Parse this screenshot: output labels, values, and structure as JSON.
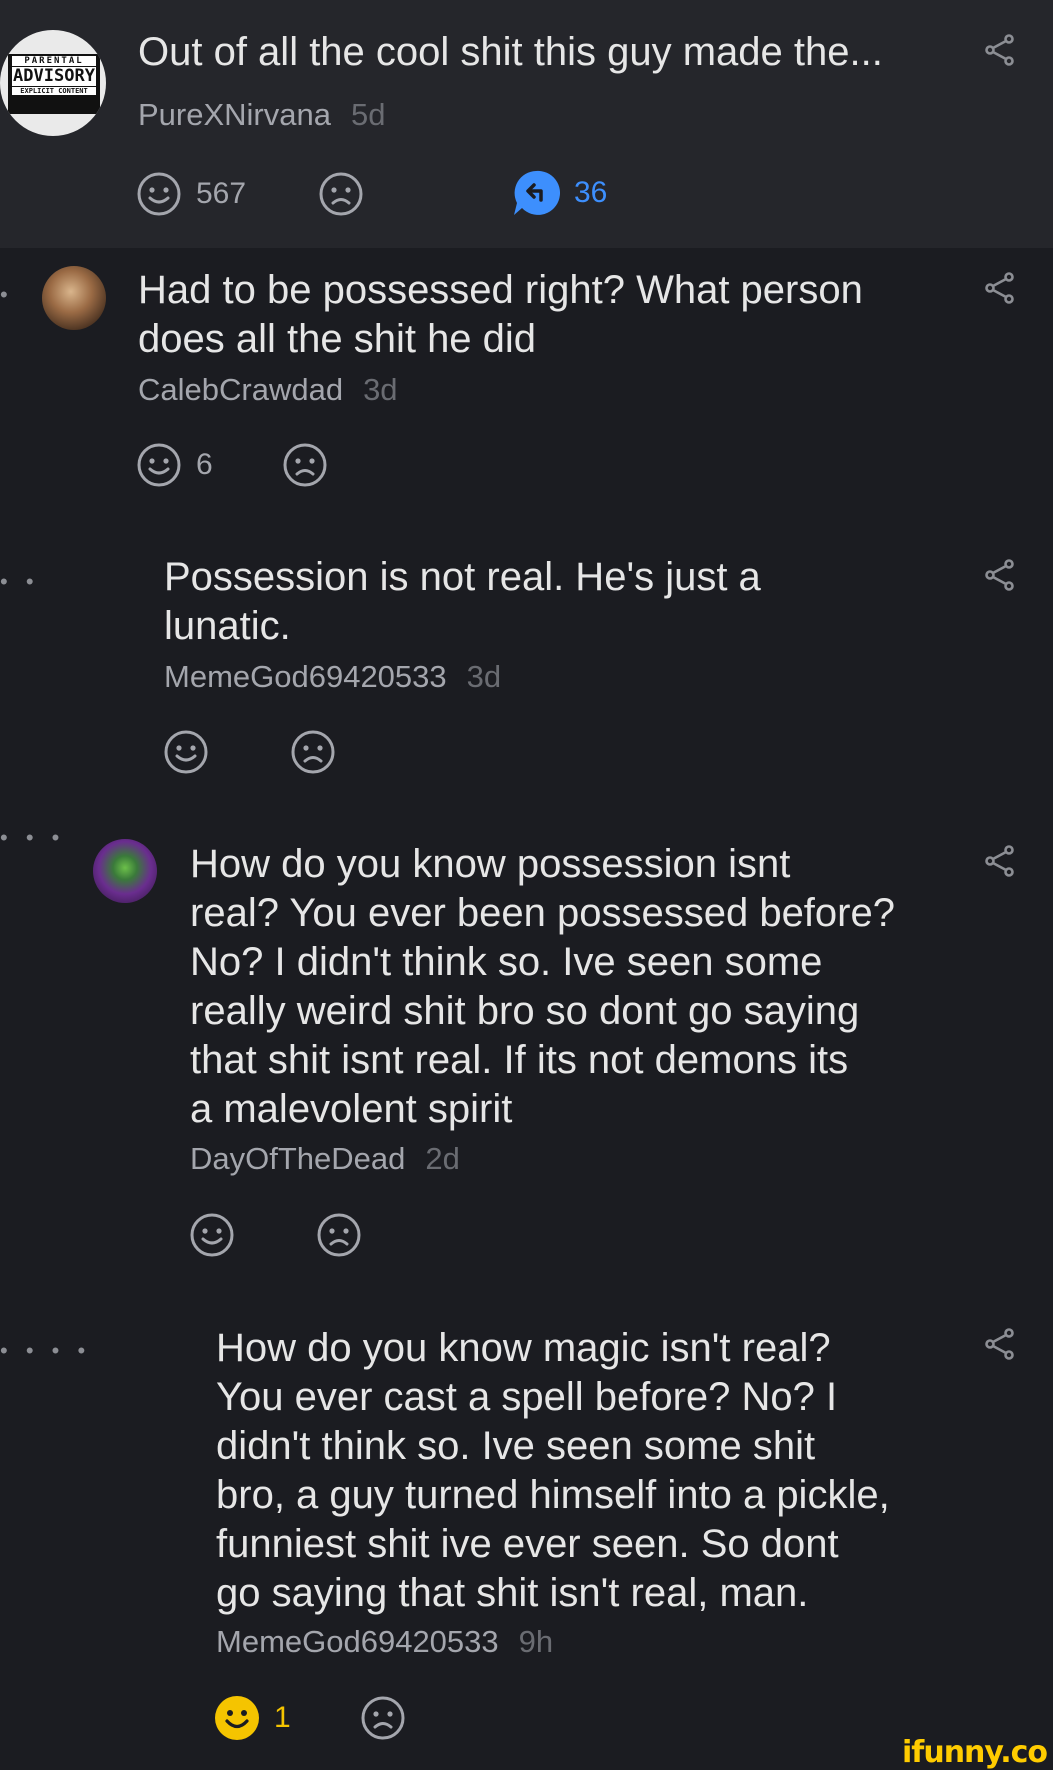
{
  "op": {
    "text": "Out of all the cool shit this guy made the...",
    "author": "PureXNirvana",
    "age": "5d",
    "likes": "567",
    "replies": "36",
    "avatar": {
      "line1": "PARENTAL",
      "line2": "ADVISORY",
      "line3": "EXPLICIT CONTENT"
    }
  },
  "comments": [
    {
      "text": "Had to be possessed right? What person\ndoes all the shit he did",
      "author": "CalebCrawdad",
      "age": "3d",
      "likes": "6",
      "depth_dots": "•"
    },
    {
      "text": "Possession is not real. He's just a\nlunatic.",
      "author": "MemeGod69420533",
      "age": "3d",
      "likes": "",
      "depth_dots": "• •"
    },
    {
      "text": "How do you know possession isnt\nreal? You ever been possessed before?\nNo? I didn't think so. Ive seen some\nreally weird shit bro so dont go saying\nthat shit isnt real. If its not demons its\na malevolent spirit",
      "author": "DayOfTheDead",
      "age": "2d",
      "likes": "",
      "depth_dots": "• • •"
    },
    {
      "text": "How do you know magic isn't real?\nYou ever cast a spell before? No? I\ndidn't think so. Ive seen some shit\nbro, a guy turned himself into a pickle,\nfunniest shit ive ever seen. So dont\ngo saying that shit isn't real, man.",
      "author": "MemeGod69420533",
      "age": "9h",
      "likes": "1",
      "depth_dots": "• • • •"
    }
  ],
  "watermark": "ifunny.co",
  "colors": {
    "accent_blue": "#3d8ffd",
    "smile_active": "#f5c400",
    "background": "#1b1c21",
    "op_background": "#25262b"
  },
  "icons": [
    "smile-icon",
    "frown-icon",
    "reply-icon",
    "share-icon"
  ]
}
